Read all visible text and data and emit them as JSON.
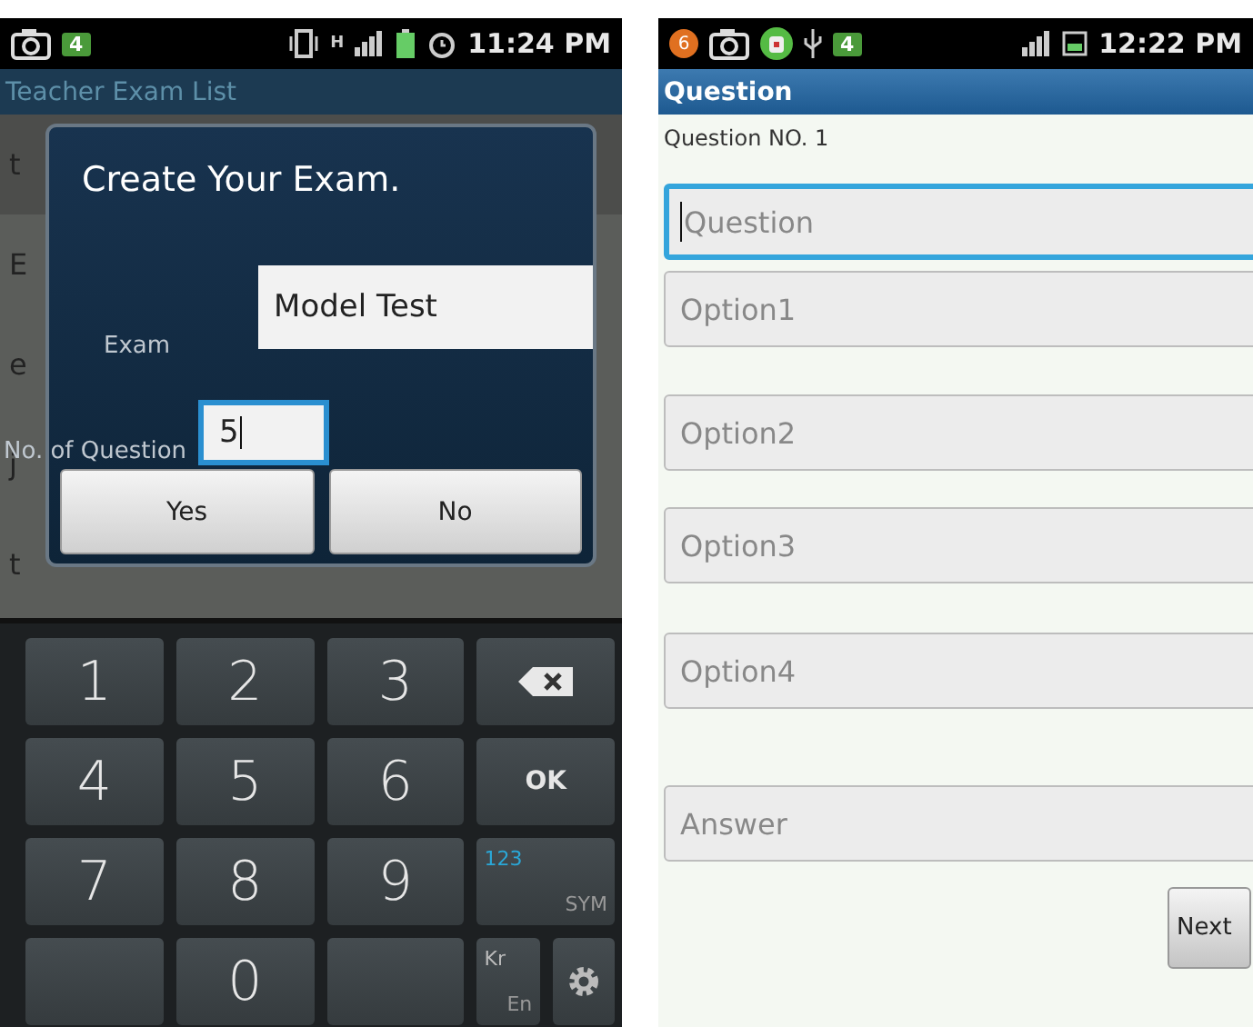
{
  "left_phone": {
    "status_bar": {
      "badge": "4",
      "network": "H",
      "time": "11:24 PM"
    },
    "title": "Teacher Exam List",
    "list_items": [
      "t",
      "E",
      "e",
      "j",
      "t"
    ],
    "dialog": {
      "title": "Create Your Exam.",
      "fields": [
        {
          "label": "Exam",
          "value": "Model Test",
          "focused": false
        },
        {
          "label": "No. of Question",
          "value": "5",
          "focused": true
        }
      ],
      "buttons": [
        "Yes",
        "No"
      ]
    },
    "keyboard": [
      {
        "kind": "digit",
        "label": "1"
      },
      {
        "kind": "digit",
        "label": "2"
      },
      {
        "kind": "digit",
        "label": "3"
      },
      {
        "kind": "backspace"
      },
      {
        "kind": "digit",
        "label": "4"
      },
      {
        "kind": "digit",
        "label": "5"
      },
      {
        "kind": "digit",
        "label": "6"
      },
      {
        "kind": "ok",
        "label": "OK"
      },
      {
        "kind": "digit",
        "label": "7"
      },
      {
        "kind": "digit",
        "label": "8"
      },
      {
        "kind": "digit",
        "label": "9"
      },
      {
        "kind": "sym",
        "label": "123",
        "sublabel": "SYM"
      },
      {
        "kind": "blank"
      },
      {
        "kind": "digit",
        "label": "0"
      },
      {
        "kind": "blank"
      },
      {
        "kind": "lang",
        "label": "Kr",
        "sublabel": "En"
      },
      {
        "kind": "settings"
      }
    ]
  },
  "right_phone": {
    "status_bar": {
      "notification_count": "6",
      "badge": "4",
      "time": "12:22 PM"
    },
    "title": "Question",
    "question_number": "Question NO. 1",
    "fields": [
      {
        "placeholder": "Question",
        "focused": true
      },
      {
        "placeholder": "Option1",
        "focused": false
      },
      {
        "placeholder": "Option2",
        "focused": false
      },
      {
        "placeholder": "Option3",
        "focused": false
      },
      {
        "placeholder": "Option4",
        "focused": false
      },
      {
        "placeholder": "Answer",
        "focused": false
      }
    ],
    "next_button": "Next"
  }
}
